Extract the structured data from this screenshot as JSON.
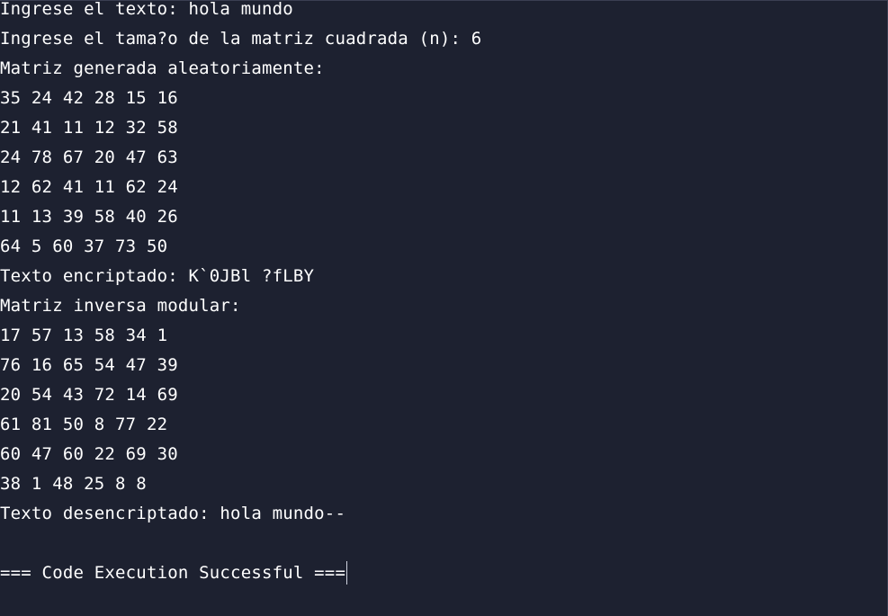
{
  "console": {
    "lines": [
      "Ingrese el texto: hola mundo",
      "Ingrese el tama?o de la matriz cuadrada (n): 6",
      "Matriz generada aleatoriamente:",
      "35 24 42 28 15 16",
      "21 41 11 12 32 58",
      "24 78 67 20 47 63",
      "12 62 41 11 62 24",
      "11 13 39 58 40 26",
      "64 5 60 37 73 50",
      "Texto encriptado: K`0JBl ?fLBY",
      "Matriz inversa modular:",
      "17 57 13 58 34 1",
      "76 16 65 54 47 39",
      "20 54 43 72 14 69",
      "61 81 50 8 77 22",
      "60 47 60 22 69 30",
      "38 1 48 25 8 8",
      "Texto desencriptado: hola mundo--",
      "=== Code Execution Successful ==="
    ]
  },
  "colors": {
    "background": "#1d2130",
    "text": "#ffffff"
  }
}
